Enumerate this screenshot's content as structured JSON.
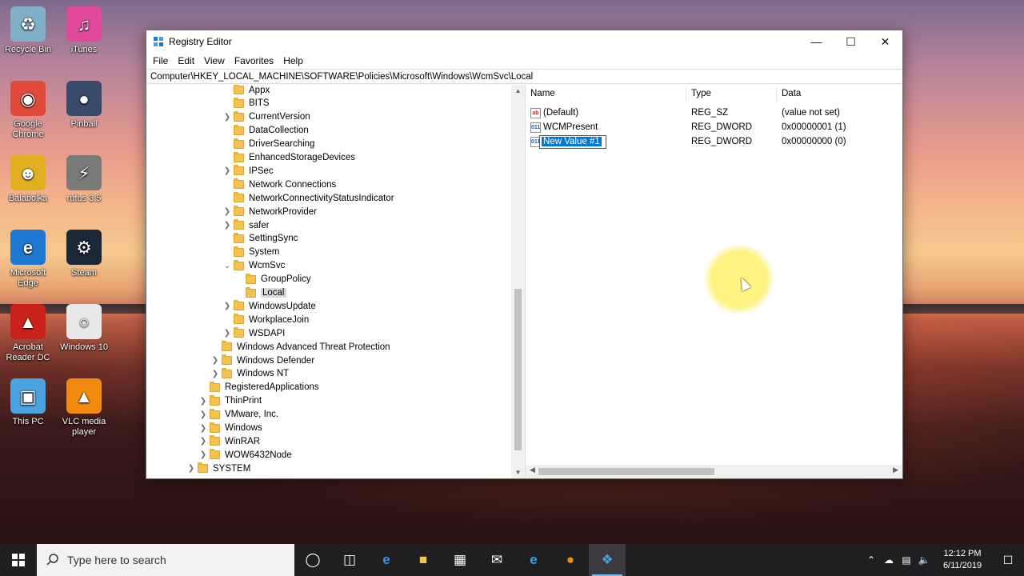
{
  "desktop": {
    "icons": [
      {
        "label": "Recycle Bin",
        "icon": "recycle-bin-icon",
        "color": "#7fb0c8"
      },
      {
        "label": "iTunes",
        "icon": "itunes-icon",
        "color": "#e14a9a"
      },
      {
        "label": "Google Chrome",
        "icon": "chrome-icon",
        "color": "#e04a3a"
      },
      {
        "label": "Pinball",
        "icon": "pinball-icon",
        "color": "#3a4a6a"
      },
      {
        "label": "Balabolka",
        "icon": "balabolka-icon",
        "color": "#e0b020"
      },
      {
        "label": "rufus 3.5",
        "icon": "rufus-icon",
        "color": "#7a7a7a"
      },
      {
        "label": "Microsoft Edge",
        "icon": "edge-icon",
        "color": "#1e78d2"
      },
      {
        "label": "Steam",
        "icon": "steam-icon",
        "color": "#1b2838"
      },
      {
        "label": "Acrobat Reader DC",
        "icon": "acrobat-icon",
        "color": "#c8221a"
      },
      {
        "label": "Windows 10",
        "icon": "disc-image-icon",
        "color": "#e8e8e8"
      },
      {
        "label": "This PC",
        "icon": "computer-icon",
        "color": "#4aa3df"
      },
      {
        "label": "VLC media player",
        "icon": "vlc-icon",
        "color": "#f08a10"
      }
    ]
  },
  "window": {
    "title": "Registry Editor",
    "menu": [
      "File",
      "Edit",
      "View",
      "Favorites",
      "Help"
    ],
    "address": "Computer\\HKEY_LOCAL_MACHINE\\SOFTWARE\\Policies\\Microsoft\\Windows\\WcmSvc\\Local",
    "tree": [
      {
        "label": "Appx",
        "expander": ""
      },
      {
        "label": "BITS",
        "expander": ""
      },
      {
        "label": "CurrentVersion",
        "expander": ">"
      },
      {
        "label": "DataCollection",
        "expander": ""
      },
      {
        "label": "DriverSearching",
        "expander": ""
      },
      {
        "label": "EnhancedStorageDevices",
        "expander": ""
      },
      {
        "label": "IPSec",
        "expander": ">"
      },
      {
        "label": "Network Connections",
        "expander": ""
      },
      {
        "label": "NetworkConnectivityStatusIndicator",
        "expander": ""
      },
      {
        "label": "NetworkProvider",
        "expander": ">"
      },
      {
        "label": "safer",
        "expander": ">"
      },
      {
        "label": "SettingSync",
        "expander": ""
      },
      {
        "label": "System",
        "expander": ""
      },
      {
        "label": "WcmSvc",
        "expander": "v"
      },
      {
        "label": "GroupPolicy",
        "expander": ""
      },
      {
        "label": "Local",
        "expander": "",
        "selected": true
      },
      {
        "label": "WindowsUpdate",
        "expander": ">"
      },
      {
        "label": "WorkplaceJoin",
        "expander": ""
      },
      {
        "label": "WSDAPI",
        "expander": ">"
      },
      {
        "label": "Windows Advanced Threat Protection",
        "expander": ""
      },
      {
        "label": "Windows Defender",
        "expander": ">"
      },
      {
        "label": "Windows NT",
        "expander": ">"
      },
      {
        "label": "RegisteredApplications",
        "expander": ""
      },
      {
        "label": "ThinPrint",
        "expander": ">"
      },
      {
        "label": "VMware, Inc.",
        "expander": ">"
      },
      {
        "label": "Windows",
        "expander": ">"
      },
      {
        "label": "WinRAR",
        "expander": ">"
      },
      {
        "label": "WOW6432Node",
        "expander": ">"
      },
      {
        "label": "SYSTEM",
        "expander": ">"
      }
    ],
    "columns": {
      "name": "Name",
      "type": "Type",
      "data": "Data"
    },
    "values": [
      {
        "name": "(Default)",
        "type": "REG_SZ",
        "data": "(value not set)",
        "icon": "string-value-icon"
      },
      {
        "name": "WCMPresent",
        "type": "REG_DWORD",
        "data": "0x00000001 (1)",
        "icon": "binary-value-icon"
      },
      {
        "name": "New Value #1",
        "type": "REG_DWORD",
        "data": "0x00000000 (0)",
        "icon": "binary-value-icon",
        "editing": true
      }
    ]
  },
  "taskbar": {
    "search_placeholder": "Type here to search",
    "apps": [
      "cortana-icon",
      "task-view-icon",
      "edge-icon",
      "file-explorer-icon",
      "store-icon",
      "mail-icon",
      "internet-explorer-icon",
      "firefox-icon",
      "registry-editor-icon"
    ],
    "active_app": "registry-editor-icon",
    "time": "12:12 PM",
    "date": "6/11/2019"
  }
}
